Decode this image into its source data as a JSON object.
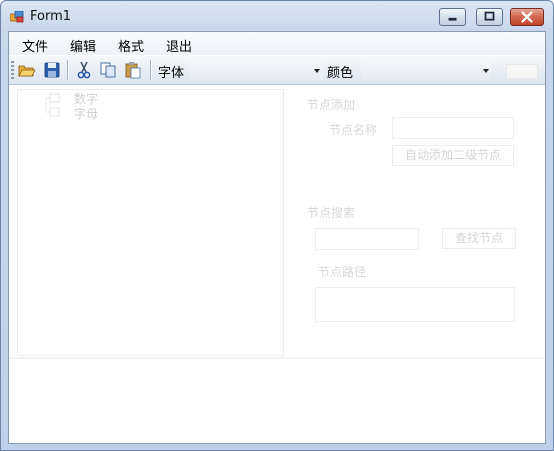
{
  "window": {
    "title": "Form1",
    "icons": {
      "app": "form-app-icon",
      "minimize": "minimize-icon",
      "maximize": "maximize-icon",
      "close": "close-icon"
    }
  },
  "menu": {
    "items": [
      {
        "label": "文件"
      },
      {
        "label": "编辑"
      },
      {
        "label": "格式"
      },
      {
        "label": "退出"
      }
    ]
  },
  "toolbar": {
    "icons": [
      "open-folder-icon",
      "save-icon",
      "cut-icon",
      "copy-icon",
      "paste-icon"
    ],
    "font_label": "字体",
    "font_value": "",
    "color_label": "颜色",
    "color_value": ""
  },
  "tree": {
    "nodes": [
      {
        "label": "数字"
      },
      {
        "label": "字母"
      }
    ]
  },
  "side_panel": {
    "add_group_title": "节点添加",
    "node_name_label": "节点名称",
    "node_name_value": "",
    "auto_add_button": "自动添加二级节点",
    "search_group_title": "节点搜索",
    "search_value": "",
    "find_button": "查找节点",
    "path_label": "节点路径",
    "path_value": ""
  }
}
